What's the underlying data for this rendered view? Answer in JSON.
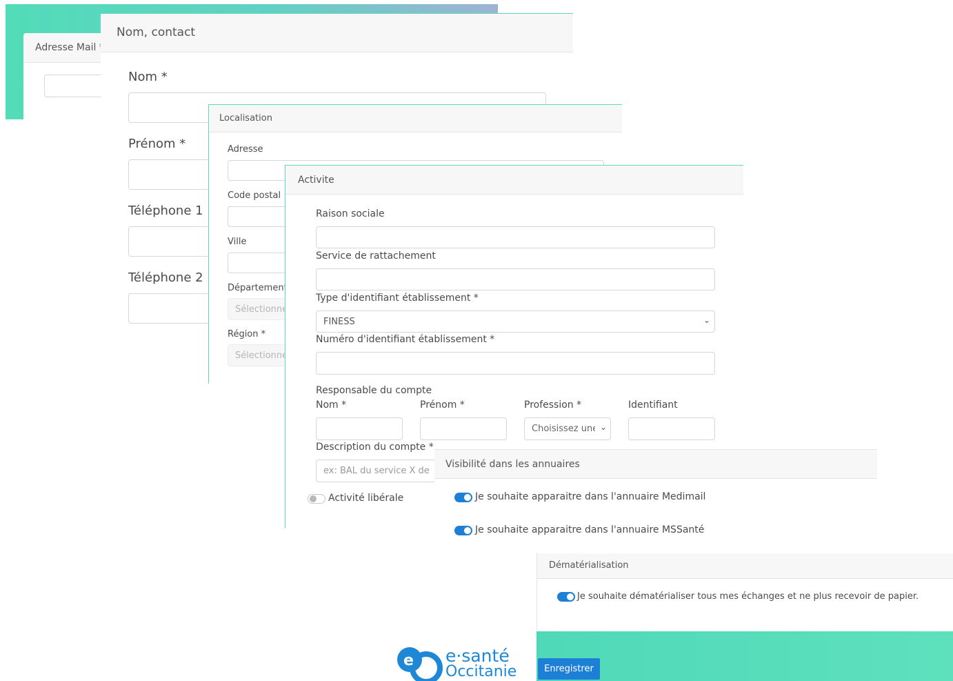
{
  "colors": {
    "accent": "#4fd9b8",
    "button": "#1e7fd6",
    "header_bg": "#f7f7f7"
  },
  "mail_panel": {
    "label": "Adresse Mail *"
  },
  "contact": {
    "header": "Nom, contact",
    "nom": "Nom *",
    "prenom": "Prénom *",
    "tel1": "Téléphone 1",
    "tel2": "Téléphone 2"
  },
  "localisation": {
    "header": "Localisation",
    "adresse": "Adresse",
    "code_postal": "Code postal",
    "ville": "Ville",
    "departement": "Département",
    "departement_placeholder": "Sélectionne",
    "region": "Région *",
    "region_placeholder": "Sélectionne"
  },
  "activite": {
    "header": "Activite",
    "raison_sociale": "Raison sociale",
    "service": "Service de rattachement",
    "type_id": "Type d'identifiant établissement *",
    "type_id_value": "FINESS",
    "numero_id": "Numéro d'identifiant établissement *",
    "responsable": "Responsable du compte",
    "resp_nom": "Nom *",
    "resp_prenom": "Prénom *",
    "resp_profession": "Profession *",
    "resp_identifiant": "Identifiant",
    "profession_value": "Choisissez une",
    "description": "Description du compte *",
    "description_placeholder": "ex: BAL du service X de",
    "liberale": "Activité libérale"
  },
  "visibilite": {
    "header": "Visibilité dans les annuaires",
    "medimail": "Je souhaite apparaitre dans l'annuaire Medimail",
    "mssante": "Je souhaite apparaitre dans l'annuaire MSSanté"
  },
  "dematerialisation": {
    "header": "Dématérialisation",
    "option": "Je souhaite dématérialiser tous mes échanges et ne plus recevoir de papier."
  },
  "footer": {
    "save_button": "Enregistrer"
  },
  "logo": {
    "line1": "e·santé",
    "line2": "Occitanie"
  }
}
